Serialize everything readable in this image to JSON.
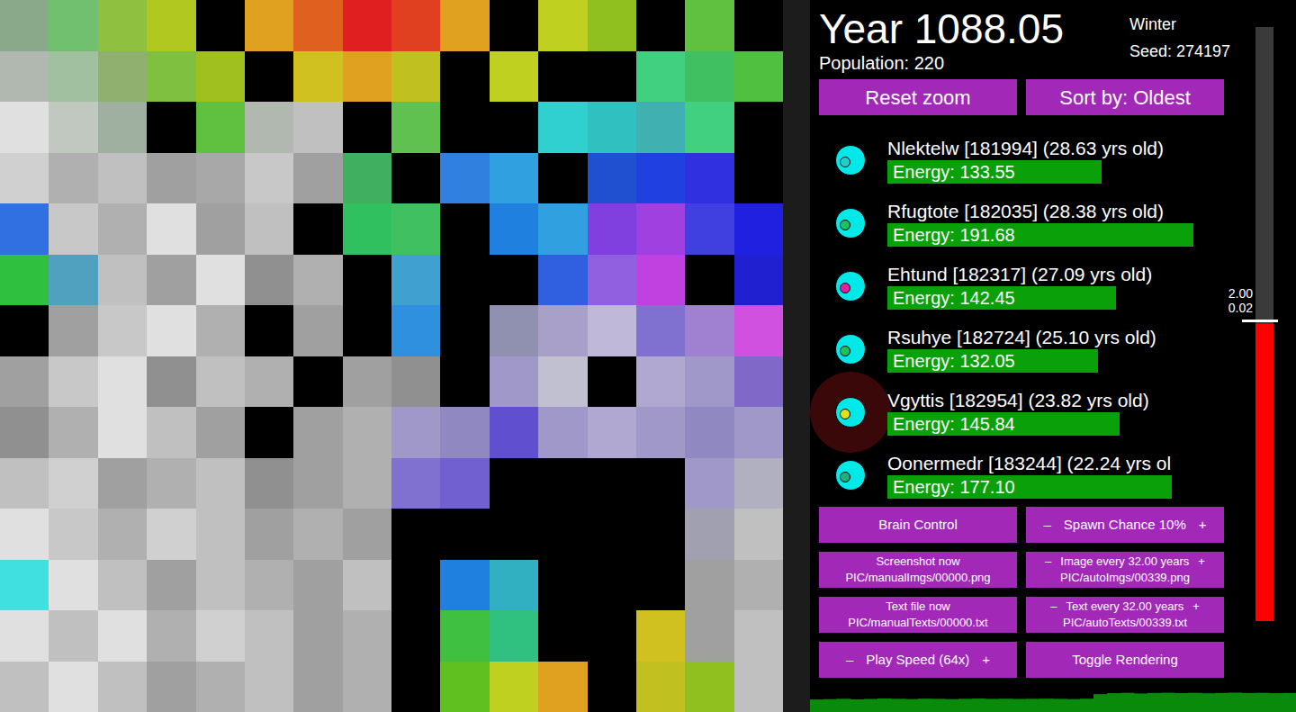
{
  "header": {
    "year": "Year 1088.05",
    "season": "Winter",
    "seed": "Seed: 274197",
    "population": "Population: 220"
  },
  "top_buttons": [
    "Reset zoom",
    "Sort by: Oldest"
  ],
  "creatures": [
    {
      "name": "Nlektelw [181994] (28.63 yrs old)",
      "energy": "Energy: 133.55",
      "level": 0.58,
      "color": "#00e8e8",
      "mouth_color": "#20d0d0",
      "selected": false
    },
    {
      "name": "Rfugtote [182035] (28.38 yrs old)",
      "energy": "Energy: 191.68",
      "level": 0.83,
      "color": "#00e8e8",
      "mouth_color": "#20c060",
      "selected": false
    },
    {
      "name": "Ehtund [182317] (27.09 yrs old)",
      "energy": "Energy: 142.45",
      "level": 0.62,
      "color": "#00e8e8",
      "mouth_color": "#e020a0",
      "selected": false
    },
    {
      "name": "Rsuhye [182724] (25.10 yrs old)",
      "energy": "Energy: 132.05",
      "level": 0.57,
      "color": "#00e8e8",
      "mouth_color": "#20c060",
      "selected": false
    },
    {
      "name": "Vgyttis [182954] (23.82 yrs old)",
      "energy": "Energy: 145.84",
      "level": 0.63,
      "color": "#00e8e8",
      "mouth_color": "#e0e020",
      "selected": true
    },
    {
      "name": "Oonermedr [183244] (22.24 yrs ol",
      "energy": "Energy: 177.10",
      "level": 0.77,
      "color": "#00e8e8",
      "mouth_color": "#20b080",
      "selected": false
    }
  ],
  "controls": [
    {
      "kind": "single",
      "label": "Brain Control"
    },
    {
      "kind": "stepper",
      "minus": "–",
      "label": "Spawn Chance 10%",
      "plus": "+"
    },
    {
      "kind": "double",
      "label": "Screenshot now",
      "sub": "PIC/manualImgs/00000.png"
    },
    {
      "kind": "stepper2",
      "minus": "–",
      "label": "Image every 32.00 years",
      "plus": "+",
      "sub": "PIC/autoImgs/00339.png"
    },
    {
      "kind": "double",
      "label": "Text file now",
      "sub": "PIC/manualTexts/00000.txt"
    },
    {
      "kind": "stepper2",
      "minus": "–",
      "label": "Text every 32.00 years",
      "plus": "+",
      "sub": "PIC/autoTexts/00339.txt"
    },
    {
      "kind": "stepper",
      "minus": "–",
      "label": "Play Speed (64x)",
      "plus": "+"
    },
    {
      "kind": "single",
      "label": "Toggle Rendering"
    }
  ],
  "gauge": {
    "labels": [
      "2.00",
      "0.02"
    ],
    "level": 0.5
  },
  "population_graph": {
    "values": [
      190,
      195,
      200,
      192,
      198,
      205,
      200,
      196,
      202,
      199,
      195,
      200,
      204,
      198,
      201,
      197,
      200,
      203,
      199,
      196,
      202,
      270,
      285,
      290,
      280,
      288,
      292,
      286,
      290,
      284,
      289,
      293,
      287,
      290,
      285,
      288
    ]
  },
  "map": {
    "tiles": [
      [
        "#8aa88a",
        "#70c070",
        "#90c040",
        "#b0c820",
        "#000000",
        "#e0a020",
        "#e06020",
        "#e02020",
        "#e04020",
        "#e0a020",
        "#000000",
        "#c0d020",
        "#90c020",
        "#000000",
        "#60c040",
        "#000000"
      ],
      [
        "#b0b8b0",
        "#a0c0a0",
        "#90b070",
        "#80c040",
        "#a0c020",
        "#000000",
        "#d0c020",
        "#e0a020",
        "#c0c020",
        "#000000",
        "#c0d020",
        "#000000",
        "#000000",
        "#40d080",
        "#40c060",
        "#50c040"
      ],
      [
        "#e0e0e0",
        "#c0c8c0",
        "#a0b0a0",
        "#000000",
        "#60c040",
        "#b0b8b0",
        "#c0c0c0",
        "#000000",
        "#60c050",
        "#000000",
        "#000000",
        "#30d0d0",
        "#30c0c0",
        "#40b0b0",
        "#40d080",
        "#000000"
      ],
      [
        "#d0d0d0",
        "#b0b0b0",
        "#c0c0c0",
        "#a0a0a0",
        "#a8a8a8",
        "#c8c8c8",
        "#a0a0a0",
        "#40b060",
        "#000000",
        "#3080e0",
        "#30a0e0",
        "#000000",
        "#2050d0",
        "#2040e0",
        "#3030e0",
        "#000000"
      ],
      [
        "#3070e0",
        "#c8c8c8",
        "#b0b0b0",
        "#e0e0e0",
        "#a0a0a0",
        "#c0c0c0",
        "#000000",
        "#30c060",
        "#40c060",
        "#000000",
        "#2080e0",
        "#30a0e0",
        "#8040e0",
        "#a040e0",
        "#4040e0",
        "#2020e0"
      ],
      [
        "#30c040",
        "#50a0c0",
        "#c0c0c0",
        "#a0a0a0",
        "#e0e0e0",
        "#909090",
        "#b0b0b0",
        "#000000",
        "#40a0d0",
        "#000000",
        "#000000",
        "#3060e0",
        "#9060e0",
        "#c040e0",
        "#000000",
        "#2020d0"
      ],
      [
        "#000000",
        "#a0a0a0",
        "#c8c8c8",
        "#e0e0e0",
        "#b0b0b0",
        "#000000",
        "#a0a0a0",
        "#000000",
        "#3090e0",
        "#000000",
        "#9090b0",
        "#a8a0c8",
        "#c0b8d8",
        "#8070d0",
        "#a080d0",
        "#d050e0"
      ],
      [
        "#a0a0a0",
        "#c8c8c8",
        "#e0e0e0",
        "#909090",
        "#c0c0c0",
        "#b0b0b0",
        "#000000",
        "#a0a0a0",
        "#909090",
        "#000000",
        "#a098c8",
        "#c0c0d0",
        "#000000",
        "#b0a8d0",
        "#a098c8",
        "#8068c8"
      ],
      [
        "#909090",
        "#b0b0b0",
        "#e0e0e0",
        "#c0c0c0",
        "#a0a0a0",
        "#000000",
        "#a0a0a0",
        "#b0b0b0",
        "#a098c8",
        "#9088c0",
        "#6050d0",
        "#a098c8",
        "#b0a8d0",
        "#a098c8",
        "#9088c0",
        "#a098c8"
      ],
      [
        "#c0c0c0",
        "#d0d0d0",
        "#a0a0a0",
        "#b0b0b0",
        "#c0c0c0",
        "#909090",
        "#a0a0a0",
        "#b0b0b0",
        "#8070d0",
        "#7060d0",
        "#000000",
        "#000000",
        "#000000",
        "#000000",
        "#a098c8",
        "#b0b0c0"
      ],
      [
        "#e0e0e0",
        "#c8c8c8",
        "#b0b0b0",
        "#d0d0d0",
        "#c0c0c0",
        "#a0a0a0",
        "#b0b0b0",
        "#a0a0a0",
        "#000000",
        "#000000",
        "#000000",
        "#000000",
        "#000000",
        "#000000",
        "#a0a0b0",
        "#c0c0c0"
      ],
      [
        "#40e0e0",
        "#e0e0e0",
        "#c0c0c0",
        "#a0a0a0",
        "#c0c0c0",
        "#b0b0b0",
        "#a0a0a0",
        "#c0c0c0",
        "#000000",
        "#2080e0",
        "#30b0c0",
        "#000000",
        "#000000",
        "#000000",
        "#a0a0a0",
        "#b0b0b0"
      ],
      [
        "#e0e0e0",
        "#c0c0c0",
        "#e0e0e0",
        "#b0b0b0",
        "#d0d0d0",
        "#c0c0c0",
        "#a0a0a0",
        "#b0b0b0",
        "#000000",
        "#40c040",
        "#30c080",
        "#000000",
        "#000000",
        "#d0c020",
        "#a0a0a0",
        "#c0c0c0"
      ],
      [
        "#c0c0c0",
        "#e0e0e0",
        "#c0c0c0",
        "#a0a0a0",
        "#b0b0b0",
        "#c0c0c0",
        "#a0a0a0",
        "#b0b0b0",
        "#000000",
        "#60c020",
        "#c0d020",
        "#e0a020",
        "#000000",
        "#c0c020",
        "#90c020",
        "#c0c0c0"
      ]
    ]
  }
}
